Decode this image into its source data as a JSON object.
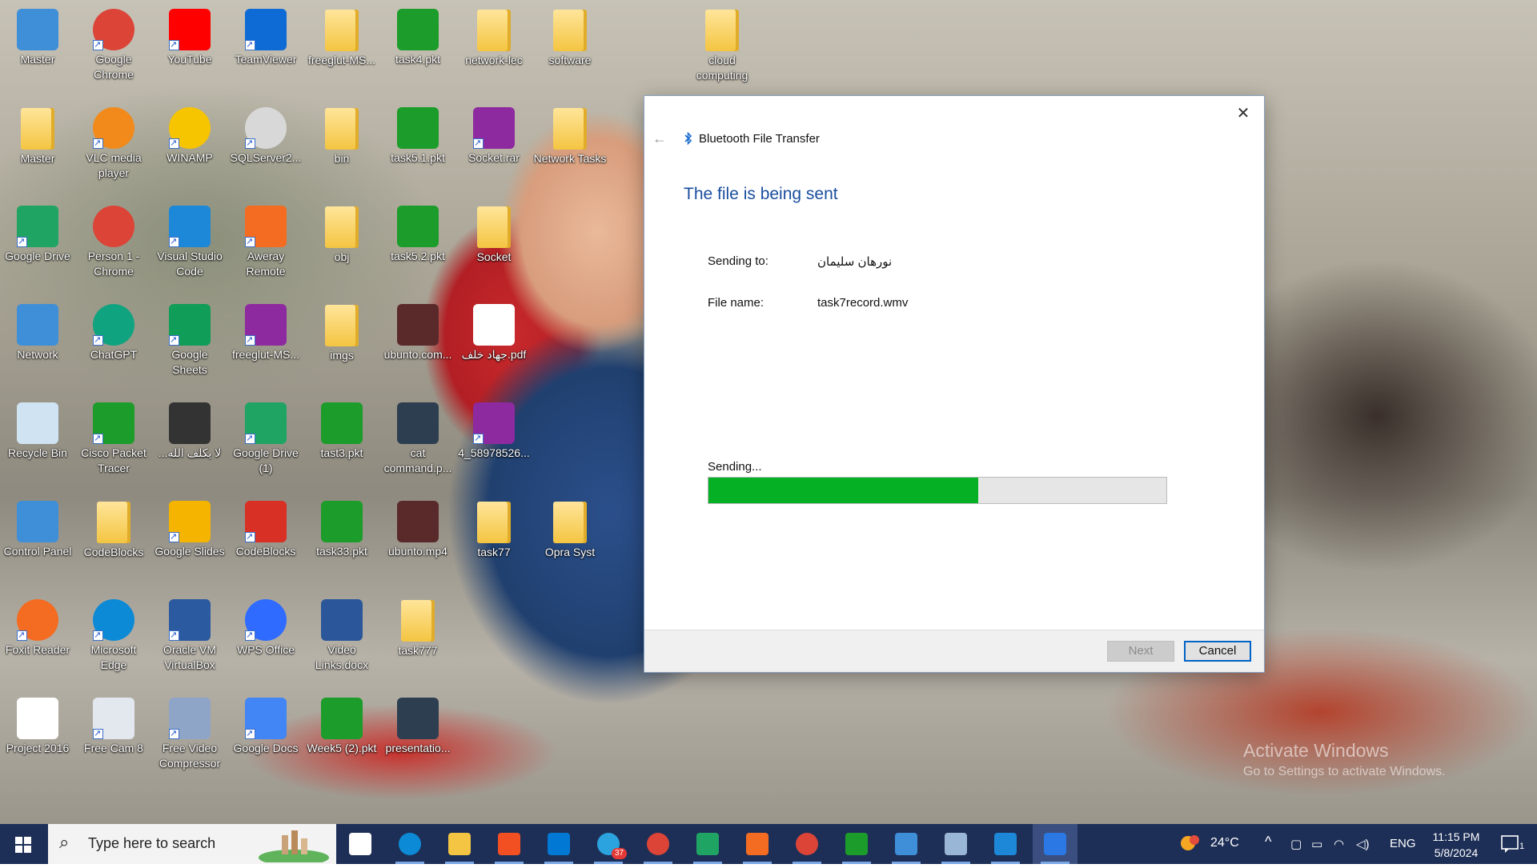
{
  "desktop": {
    "icons": [
      {
        "label": "Master",
        "icon": "computer-icon",
        "color": "#3f8fd8"
      },
      {
        "label": "Google Chrome",
        "icon": "chrome-icon",
        "color": "#db4437"
      },
      {
        "label": "YouTube",
        "icon": "youtube-icon",
        "color": "#ff0000"
      },
      {
        "label": "TeamViewer",
        "icon": "teamviewer-icon",
        "color": "#0e6bd6"
      },
      {
        "label": "freeglut-MS...",
        "icon": "folder-icon",
        "color": "#f4c542"
      },
      {
        "label": "task4.pkt",
        "icon": "packet-tracer-file-icon",
        "color": "#1c9c2a"
      },
      {
        "label": "network-lec",
        "icon": "folder-icon",
        "color": "#f4c542"
      },
      {
        "label": "software",
        "icon": "folder-icon",
        "color": "#f4c542"
      },
      {
        "label": "cloud computing",
        "icon": "folder-icon",
        "color": "#f4c542"
      },
      {
        "label": "Master",
        "icon": "user-folder-icon",
        "color": "#f4c542"
      },
      {
        "label": "VLC media player",
        "icon": "vlc-icon",
        "color": "#f28a1b"
      },
      {
        "label": "WINAMP",
        "icon": "winamp-icon",
        "color": "#f7c400"
      },
      {
        "label": "SQLServer2...",
        "icon": "disc-icon",
        "color": "#d8d8d8"
      },
      {
        "label": "bin",
        "icon": "folder-icon",
        "color": "#f4c542"
      },
      {
        "label": "task5.1.pkt",
        "icon": "packet-tracer-file-icon",
        "color": "#1c9c2a"
      },
      {
        "label": "Socket.rar",
        "icon": "winrar-icon",
        "color": "#8e2aa0"
      },
      {
        "label": "Network Tasks",
        "icon": "folder-icon",
        "color": "#f4c542"
      },
      {
        "label": "Google Drive",
        "icon": "google-drive-icon",
        "color": "#1fa463"
      },
      {
        "label": "Person 1 - Chrome",
        "icon": "chrome-profile-icon",
        "color": "#db4437"
      },
      {
        "label": "Visual Studio Code",
        "icon": "vscode-icon",
        "color": "#1e88d8"
      },
      {
        "label": "Aweray Remote",
        "icon": "aweray-icon",
        "color": "#f36c21"
      },
      {
        "label": "obj",
        "icon": "folder-icon",
        "color": "#f4c542"
      },
      {
        "label": "task5.2.pkt",
        "icon": "packet-tracer-file-icon",
        "color": "#1c9c2a"
      },
      {
        "label": "Socket",
        "icon": "folder-icon",
        "color": "#f4c542"
      },
      {
        "label": "Network",
        "icon": "network-icon",
        "color": "#3f8fd8"
      },
      {
        "label": "ChatGPT",
        "icon": "chatgpt-icon",
        "color": "#10a37f"
      },
      {
        "label": "Google Sheets",
        "icon": "google-sheets-icon",
        "color": "#0f9d58"
      },
      {
        "label": "freeglut-MS...",
        "icon": "winrar-icon",
        "color": "#8e2aa0"
      },
      {
        "label": "imgs",
        "icon": "folder-icon",
        "color": "#f4c542"
      },
      {
        "label": "ubunto.com...",
        "icon": "video-file-icon",
        "color": "#5a2a2a"
      },
      {
        "label": "جهاد خلف.pdf",
        "icon": "pdf-file-icon",
        "color": "#ffffff"
      },
      {
        "label": "Recycle Bin",
        "icon": "recycle-bin-icon",
        "color": "#cfe3f3"
      },
      {
        "label": "Cisco Packet Tracer",
        "icon": "cisco-packet-tracer-icon",
        "color": "#1c9c2a"
      },
      {
        "label": "...لا يكلف الله",
        "icon": "video-file-icon",
        "color": "#333333"
      },
      {
        "label": "Google Drive (1)",
        "icon": "google-drive-icon",
        "color": "#1fa463"
      },
      {
        "label": "tast3.pkt",
        "icon": "packet-tracer-file-icon",
        "color": "#1c9c2a"
      },
      {
        "label": "cat command.p...",
        "icon": "image-file-icon",
        "color": "#2c3e50"
      },
      {
        "label": "4_58978526...",
        "icon": "winrar-icon",
        "color": "#8e2aa0"
      },
      {
        "label": "Control Panel",
        "icon": "control-panel-icon",
        "color": "#3f8fd8"
      },
      {
        "label": "CodeBlocks",
        "icon": "folder-icon",
        "color": "#f4c542"
      },
      {
        "label": "Google Slides",
        "icon": "google-slides-icon",
        "color": "#f4b400"
      },
      {
        "label": "CodeBlocks",
        "icon": "codeblocks-icon",
        "color": "#d93025"
      },
      {
        "label": "task33.pkt",
        "icon": "packet-tracer-file-icon",
        "color": "#1c9c2a"
      },
      {
        "label": "ubunto.mp4",
        "icon": "video-file-icon",
        "color": "#5a2a2a"
      },
      {
        "label": "task77",
        "icon": "folder-icon",
        "color": "#f4c542"
      },
      {
        "label": "Opra Syst",
        "icon": "folder-icon",
        "color": "#f4c542"
      },
      {
        "label": "Foxit Reader",
        "icon": "foxit-reader-icon",
        "color": "#f36c21"
      },
      {
        "label": "Microsoft Edge",
        "icon": "edge-icon",
        "color": "#0c8ad6"
      },
      {
        "label": "Oracle VM VirtualBox",
        "icon": "virtualbox-icon",
        "color": "#2c5aa0"
      },
      {
        "label": "WPS Office",
        "icon": "wps-office-icon",
        "color": "#2f6bff"
      },
      {
        "label": "Video Links.docx",
        "icon": "word-file-icon",
        "color": "#2b579a"
      },
      {
        "label": "task777",
        "icon": "folder-icon",
        "color": "#f4c542"
      },
      {
        "label": "Project 2016",
        "icon": "file-icon",
        "color": "#ffffff"
      },
      {
        "label": "Free Cam 8",
        "icon": "free-cam-icon",
        "color": "#e3e8ef"
      },
      {
        "label": "Free Video Compressor",
        "icon": "video-compressor-icon",
        "color": "#8fa5c7"
      },
      {
        "label": "Google Docs",
        "icon": "google-docs-icon",
        "color": "#4285f4"
      },
      {
        "label": "Week5 (2).pkt",
        "icon": "packet-tracer-file-icon",
        "color": "#1c9c2a"
      },
      {
        "label": "presentatio...",
        "icon": "video-file-icon",
        "color": "#2c3e50"
      }
    ],
    "watermark": {
      "line1": "Activate Windows",
      "line2": "Go to Settings to activate Windows."
    }
  },
  "dialog": {
    "title": "Bluetooth File Transfer",
    "heading": "The file is being sent",
    "sending_to_label": "Sending to:",
    "sending_to_value": "نورهان سليمان",
    "file_name_label": "File name:",
    "file_name_value": "task7record.wmv",
    "status": "Sending...",
    "progress_fraction": 0.59,
    "next_label": "Next",
    "cancel_label": "Cancel",
    "accent": "#1a4d9e",
    "progress_color": "#06b025"
  },
  "taskbar": {
    "search_placeholder": "Type here to search",
    "apps": [
      {
        "icon": "task-view-icon",
        "color": "#ffffff"
      },
      {
        "icon": "edge-icon",
        "color": "#0c8ad6"
      },
      {
        "icon": "file-explorer-icon",
        "color": "#f4c542"
      },
      {
        "icon": "microsoft-store-icon",
        "color": "#f25022"
      },
      {
        "icon": "mail-icon",
        "color": "#0078d4"
      },
      {
        "icon": "telegram-icon",
        "color": "#2aa3df",
        "badge": "37"
      },
      {
        "icon": "chrome-profile-icon",
        "color": "#db4437"
      },
      {
        "icon": "google-drive-icon",
        "color": "#1fa463"
      },
      {
        "icon": "foxit-reader-icon",
        "color": "#f36c21"
      },
      {
        "icon": "chrome-icon",
        "color": "#db4437"
      },
      {
        "icon": "cisco-packet-tracer-icon",
        "color": "#1c9c2a"
      },
      {
        "icon": "photos-icon",
        "color": "#3f8fd8"
      },
      {
        "icon": "control-panel-icon",
        "color": "#9ab6d6"
      },
      {
        "icon": "vscode-icon",
        "color": "#1e88d8"
      },
      {
        "icon": "bluetooth-icon",
        "color": "#2b78e4"
      }
    ],
    "weather": "24°C",
    "language": "ENG",
    "time": "11:15 PM",
    "date": "5/8/2024",
    "notification_count": "1"
  }
}
